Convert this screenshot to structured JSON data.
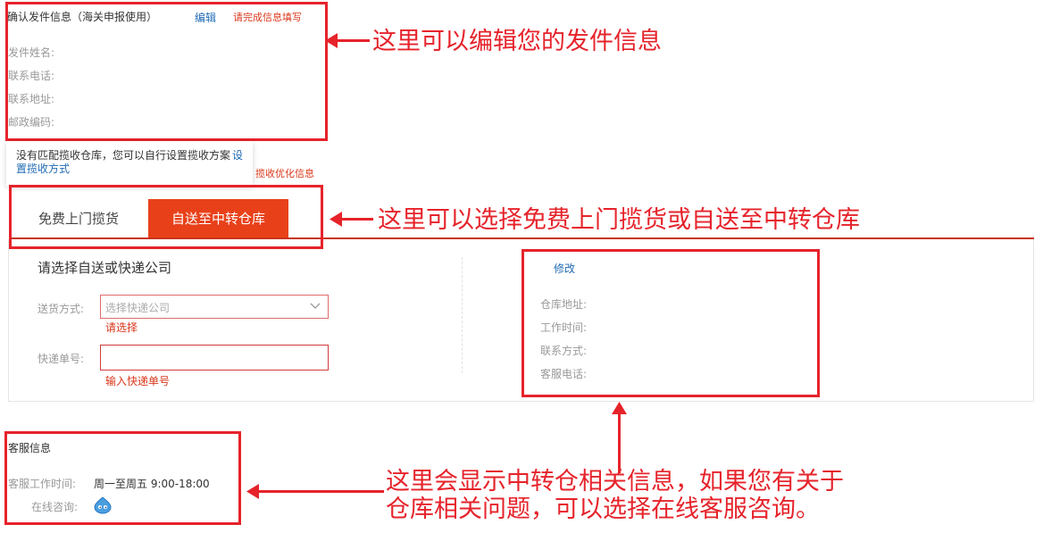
{
  "sender": {
    "title": "确认发件信息（海关申报使用）",
    "edit_link": "编辑",
    "warning": "请完成信息填写",
    "fields": [
      "发件姓名:",
      "联系电话:",
      "联系地址:",
      "邮政编码:"
    ]
  },
  "tooltip": {
    "text": "没有匹配揽收仓库，您可以自行设置揽收方案",
    "link": "设置揽收方式"
  },
  "hidden_link_fragment": "揽收优化信息",
  "tabs": {
    "pickup": "免费上门揽货",
    "self_send": "自送至中转仓库"
  },
  "form": {
    "heading": "请选择自送或快递公司",
    "delivery_label": "送货方式:",
    "delivery_placeholder": "选择快递公司",
    "delivery_error": "请选择",
    "tracking_label": "快递单号:",
    "tracking_hint": "输入快递单号"
  },
  "warehouse": {
    "modify_link": "修改",
    "fields": [
      "仓库地址:",
      "工作时间:",
      "联系方式:",
      "客服电话:"
    ]
  },
  "service": {
    "title": "客服信息",
    "hours_label": "客服工作时间:",
    "hours_value": "周一至周五 9:00-18:00",
    "online_label": "在线咨询:"
  },
  "annotations": {
    "sender_note": "这里可以编辑您的发件信息",
    "tab_note": "这里可以选择免费上门揽货或自送至中转仓库",
    "warehouse_note_line1": "这里会显示中转仓相关信息，如果您有关于",
    "warehouse_note_line2": "仓库相关问题，可以选择在线客服咨询。"
  },
  "colors": {
    "accent_red": "#e6232b",
    "tab_active": "#e8411a",
    "link_blue": "#1f6ab3"
  },
  "icons": [
    "chevron-down-icon",
    "chat-bubble-icon"
  ]
}
